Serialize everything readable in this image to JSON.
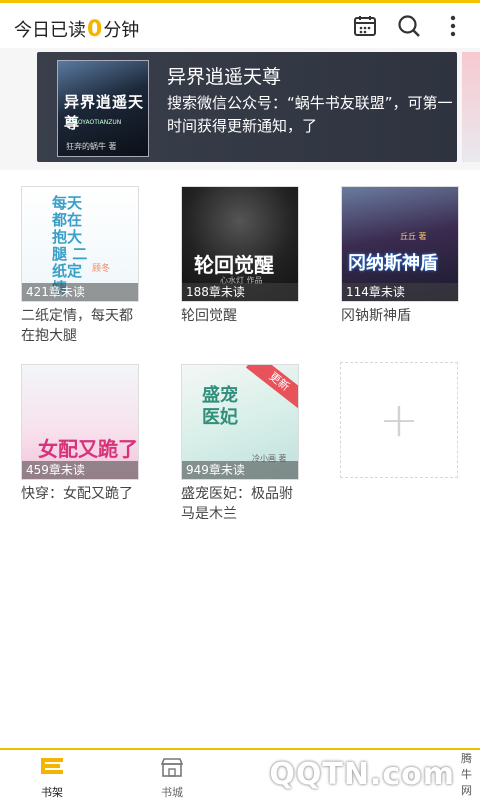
{
  "header": {
    "reading_prefix": "今日已读",
    "reading_minutes": "0",
    "reading_suffix": "分钟"
  },
  "banner": {
    "cover_title": "异界逍遥天尊",
    "cover_subtitle": "XIAOYAOTIANZUN",
    "cover_author": "狂奔的蜗牛 著",
    "title": "异界逍遥天尊",
    "description": "搜索微信公众号：“蜗牛书友联盟”，可第一时间获得更新通知，了"
  },
  "books": [
    {
      "title": "二纸定情，每天都在抱大腿",
      "unread": "421章未读",
      "cover_text": "每天都在抱大腿 二纸定情",
      "cover_author": "顾冬",
      "badge": ""
    },
    {
      "title": "轮回觉醒",
      "unread": "188章未读",
      "cover_text": "轮回觉醒",
      "cover_author": "心水灯 作品",
      "badge": ""
    },
    {
      "title": "冈钠斯神盾",
      "unread": "114章未读",
      "cover_text": "冈纳斯神盾",
      "cover_author": "丘丘 著",
      "badge": ""
    },
    {
      "title": "快穿：女配又跪了",
      "unread": "459章未读",
      "cover_text": "女配又跪了",
      "cover_author": "",
      "badge": ""
    },
    {
      "title": "盛宠医妃：极品驸马是木兰",
      "unread": "949章未读",
      "cover_text": "盛宠医妃",
      "cover_author": "冷小画 著",
      "badge": "更新"
    }
  ],
  "add_slot": {
    "symbol": "+"
  },
  "tabs": [
    {
      "label": "书架",
      "icon": "bookshelf-icon"
    },
    {
      "label": "书城",
      "icon": "store-icon"
    }
  ],
  "watermark": {
    "logo": "QQTN.com",
    "small": "腾牛网"
  },
  "colors": {
    "accent": "#f4c200",
    "badge": "#e8525a"
  }
}
